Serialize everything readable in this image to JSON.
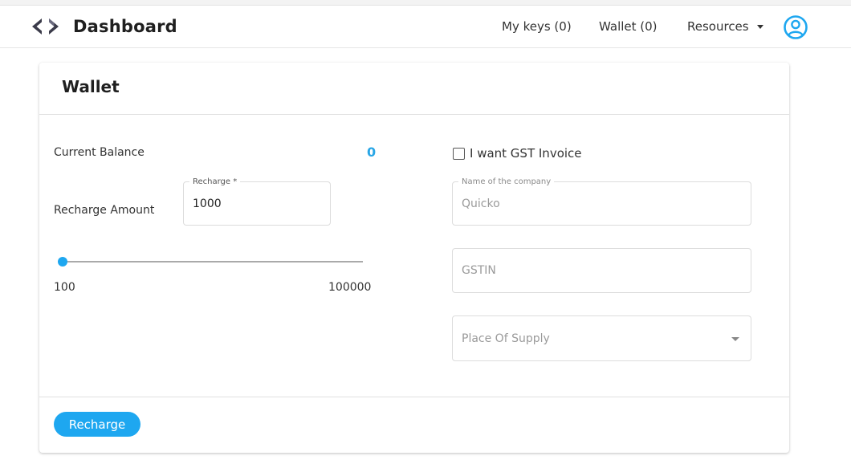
{
  "navbar": {
    "brand": "Dashboard",
    "links": [
      {
        "label": "My keys (0)"
      },
      {
        "label": "Wallet (0)"
      },
      {
        "label": "Resources"
      }
    ]
  },
  "card": {
    "title": "Wallet",
    "current_balance_label": "Current Balance",
    "current_balance_value": "0",
    "recharge_amount_label": "Recharge Amount",
    "recharge_field": {
      "legend": "Recharge *",
      "value": "1000"
    },
    "slider": {
      "min_label": "100",
      "max_label": "100000",
      "value": 1000
    },
    "gst": {
      "checkbox_label": "I want GST Invoice",
      "checked": false,
      "company": {
        "legend": "Name of the company",
        "value": "Quicko"
      },
      "gstin": {
        "placeholder": "GSTIN"
      },
      "place_of_supply": {
        "placeholder": "Place Of Supply"
      }
    },
    "recharge_button": "Recharge"
  },
  "colors": {
    "accent": "#1ea7f0",
    "balance": "#29a6e6"
  }
}
